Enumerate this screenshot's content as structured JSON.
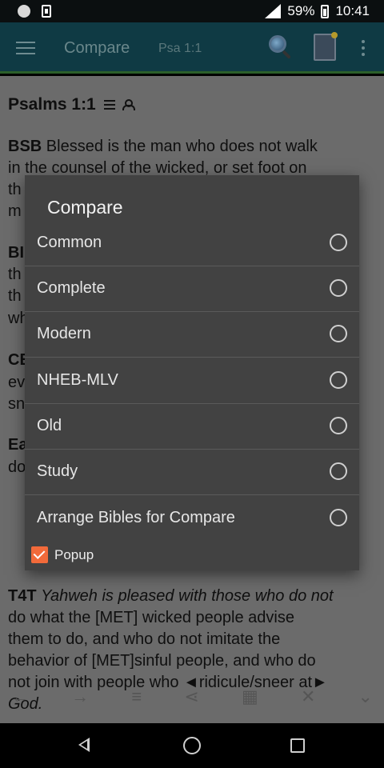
{
  "status_bar": {
    "battery_percent": "59%",
    "time": "10:41"
  },
  "app_bar": {
    "title": "Compare",
    "reference": "Psa 1:1"
  },
  "background": {
    "verse_heading": "Psalms 1:1",
    "lines": [
      {
        "abbr": "BSB",
        "text": " Blessed is the man who does not walk"
      },
      {
        "text": "in the counsel of the wicked, or set foot on"
      },
      {
        "text": "th"
      },
      {
        "text": "m"
      },
      {
        "abbr": "BI",
        "text": ""
      },
      {
        "text": "th"
      },
      {
        "text": "th"
      },
      {
        "text": "wh"
      },
      {
        "abbr": "CE",
        "text": ""
      },
      {
        "text": "ev"
      },
      {
        "text": "sn"
      },
      {
        "abbr": "Ea",
        "text": ""
      },
      {
        "text": "do"
      }
    ],
    "t4t_abbr": "T4T",
    "t4t_text": [
      "Yahweh is pleased with those who do not",
      "do what the [MET] wicked people advise",
      "them to do, and who do not imitate the",
      "behavior of [MET]sinful people, and who do",
      "not join with people who ◄ridicule/sneer at►",
      "God."
    ]
  },
  "dialog": {
    "title": "Compare",
    "options": [
      {
        "label": "Common",
        "selected": false
      },
      {
        "label": "Complete",
        "selected": false
      },
      {
        "label": "Modern",
        "selected": false
      },
      {
        "label": "NHEB-MLV",
        "selected": false
      },
      {
        "label": "Old",
        "selected": false
      },
      {
        "label": "Study",
        "selected": false
      },
      {
        "label": "Arrange Bibles for Compare",
        "selected": false
      }
    ],
    "popup_label": "Popup",
    "popup_checked": true
  },
  "colors": {
    "app_bar": "#0f3a44",
    "dialog_bg": "#424242",
    "checkbox_accent": "#f26a3a",
    "dim_overlay_bg": "#6b6b6b"
  },
  "icons": {
    "app_bar": [
      "menu-icon",
      "search-icon",
      "book-icon",
      "overflow-icon"
    ],
    "nav": [
      "back-icon",
      "home-icon",
      "recents-icon"
    ]
  }
}
